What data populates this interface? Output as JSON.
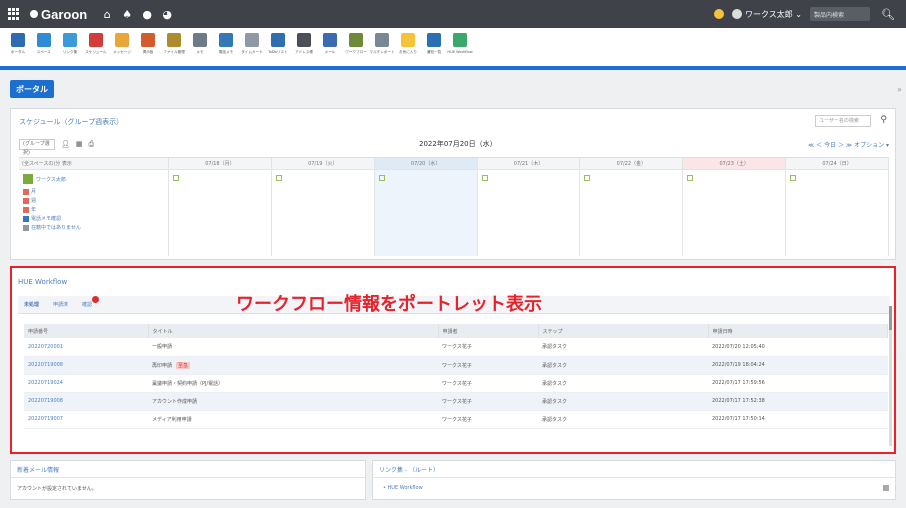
{
  "topbar": {
    "brand": "Garoon",
    "user": "ワークス太郎",
    "search_placeholder": "製品内検索"
  },
  "apps": [
    {
      "label": "ポータル",
      "color": "#2d6bb3"
    },
    {
      "label": "スペース",
      "color": "#2f8bd6"
    },
    {
      "label": "リンク集",
      "color": "#3b9bd9"
    },
    {
      "label": "スケジュール",
      "color": "#d43b3b"
    },
    {
      "label": "メッセージ",
      "color": "#e9a63a"
    },
    {
      "label": "掲示板",
      "color": "#d45b2d"
    },
    {
      "label": "ファイル管理",
      "color": "#b08a2f"
    },
    {
      "label": "メモ",
      "color": "#6d7a88"
    },
    {
      "label": "電話メモ",
      "color": "#3578b8"
    },
    {
      "label": "タイムカード",
      "color": "#8e99a5"
    },
    {
      "label": "ToDoリスト",
      "color": "#2f6fb0"
    },
    {
      "label": "アドレス帳",
      "color": "#4a4f58"
    },
    {
      "label": "メール",
      "color": "#3b6ab0"
    },
    {
      "label": "ワークフロー",
      "color": "#6e8a3a"
    },
    {
      "label": "マルチレポート",
      "color": "#7a8795"
    },
    {
      "label": "お気に入り",
      "color": "#f5c33b"
    },
    {
      "label": "通知一覧",
      "color": "#2c6fb5"
    },
    {
      "label": "HUE Workflow",
      "color": "#3aa86b"
    }
  ],
  "tab": "ポータル",
  "schedule": {
    "title": "スケジュール（グループ週表示）",
    "search_placeholder": "ユーザー名の検索",
    "group_select": "(グループ選択)",
    "date": "2022年07月20日（水）",
    "nav": "≪ ＜ 今日 ＞ ≫ オプション ▾",
    "col_first": "(全スペースの)分 表示",
    "days": [
      "07/18（月）",
      "07/19（火）",
      "07/20（水）",
      "07/21（木）",
      "07/22（金）",
      "07/23（土）",
      "07/24（日）"
    ],
    "user": "ワークス太郎",
    "links": [
      "月",
      "週",
      "年",
      "電話メモ確認",
      "在籍中ではありません"
    ]
  },
  "workflow": {
    "title": "HUE Workflow",
    "tabs": [
      "未処理",
      "申請済",
      "確認"
    ],
    "overlay": "ワークフロー情報をポートレット表示",
    "headers": [
      "申請番号",
      "タイトル",
      "申請者",
      "ステップ",
      "申請日時"
    ],
    "rows": [
      {
        "id": "20220720001",
        "title": "一般申請",
        "tag": "",
        "applicant": "ワークス花子",
        "step": "承認タスク",
        "date": "2022/07/20 12:05:40"
      },
      {
        "id": "20220719008",
        "title": "再印申請",
        "tag": "至急",
        "applicant": "ワークス花子",
        "step": "承認タスク",
        "date": "2022/07/19 18:04:24"
      },
      {
        "id": "20220719024",
        "title": "稟議申請・契約申請（PJ/電話）",
        "tag": "",
        "applicant": "ワークス花子",
        "step": "承認タスク",
        "date": "2022/07/17 17:59:56"
      },
      {
        "id": "20220719008",
        "title": "アカウント作成申請",
        "tag": "",
        "applicant": "ワークス花子",
        "step": "承認タスク",
        "date": "2022/07/17 17:52:38"
      },
      {
        "id": "20220719007",
        "title": "メディア利用申請",
        "tag": "",
        "applicant": "ワークス花子",
        "step": "承認タスク",
        "date": "2022/07/17 17:50:14"
      }
    ]
  },
  "mail": {
    "title": "新着メール情報",
    "text": "アカウントが設定されていません。"
  },
  "link_panel": {
    "title": "リンク集 - （ルート）",
    "item": "HUE Workflow"
  }
}
